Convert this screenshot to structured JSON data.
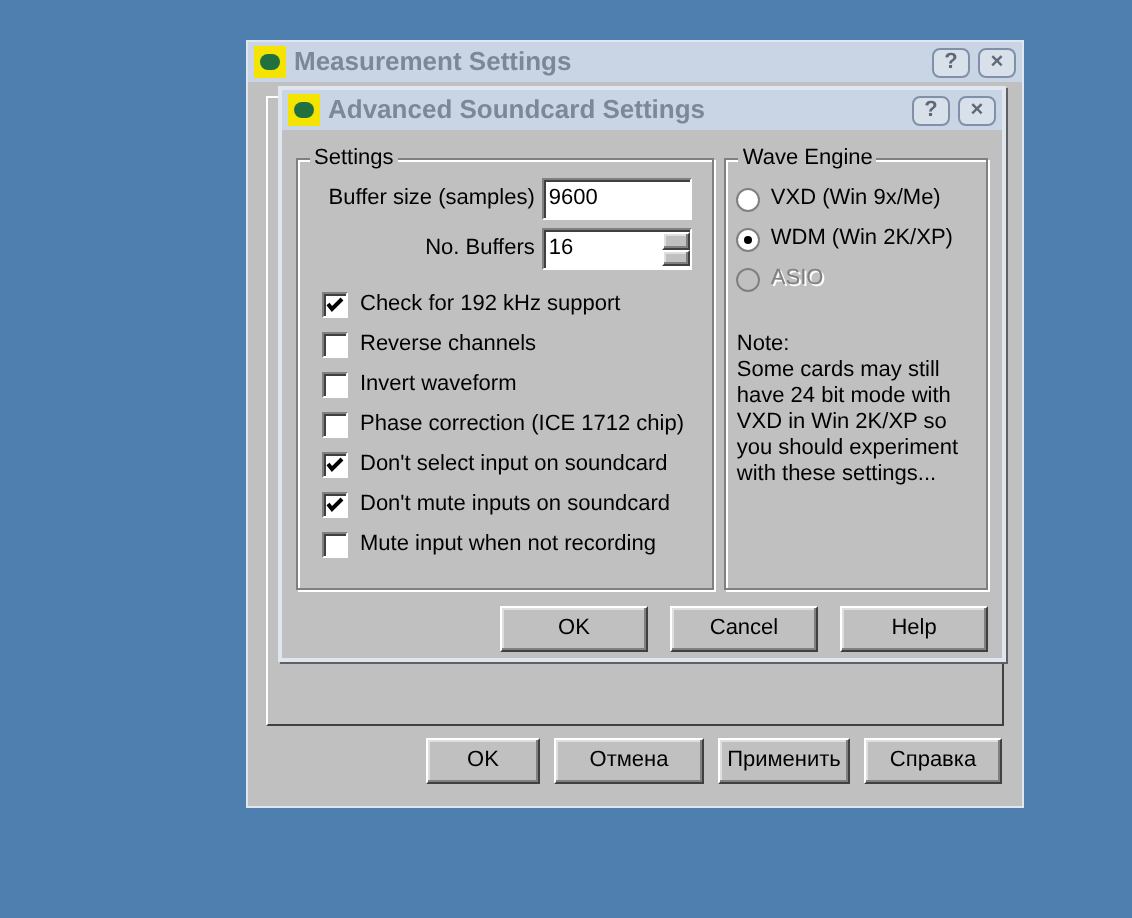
{
  "outer_window": {
    "title": "Measurement Settings",
    "title_buttons": [
      "?",
      "×"
    ],
    "buttons": [
      "OK",
      "Отмена",
      "Применить",
      "Справка"
    ]
  },
  "dialog": {
    "title": "Advanced Soundcard Settings",
    "title_buttons": [
      "?",
      "×"
    ],
    "settings_group": {
      "title": "Settings",
      "fields": [
        {
          "label": "Buffer size (samples)",
          "value": "9600",
          "kind": "text"
        },
        {
          "label": "No. Buffers",
          "value": "16",
          "kind": "spin"
        }
      ],
      "checkboxes": [
        {
          "label": "Check for 192 kHz support",
          "checked": true
        },
        {
          "label": "Reverse channels",
          "checked": false
        },
        {
          "label": "Invert waveform",
          "checked": false
        },
        {
          "label": "Phase correction (ICE 1712 chip)",
          "checked": false
        },
        {
          "label": "Don't select input on soundcard",
          "checked": true
        },
        {
          "label": "Don't mute inputs on soundcard",
          "checked": true
        },
        {
          "label": "Mute input when not recording",
          "checked": false
        }
      ]
    },
    "wave_engine_group": {
      "title": "Wave Engine",
      "options": [
        {
          "label": "VXD (Win 9x/Me)",
          "selected": false,
          "disabled": false
        },
        {
          "label": "WDM (Win 2K/XP)",
          "selected": true,
          "disabled": false
        },
        {
          "label": "ASIO",
          "selected": false,
          "disabled": true
        }
      ],
      "note": [
        "Note:",
        "Some cards may still have 24 bit mode with VXD in Win 2K/XP so you should experiment with these settings..."
      ]
    },
    "buttons": [
      "OK",
      "Cancel",
      "Help"
    ]
  }
}
